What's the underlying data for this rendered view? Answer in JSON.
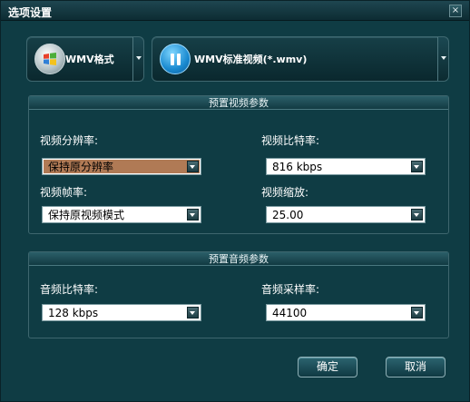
{
  "window": {
    "title": "选项设置",
    "close_glyph": "×"
  },
  "format": {
    "left": {
      "label": "WMV格式",
      "icon": "windows-logo-icon"
    },
    "right": {
      "label": "WMV标准视频(*.wmv)",
      "icon": "pause-icon"
    }
  },
  "video": {
    "heading": "预置视频参数",
    "resolution": {
      "label": "视频分辨率:",
      "value": "保持原分辨率"
    },
    "bitrate": {
      "label": "视频比特率:",
      "value": "816 kbps"
    },
    "framerate": {
      "label": "视频帧率:",
      "value": "保持原视频模式"
    },
    "zoom": {
      "label": "视频缩放:",
      "value": "25.00"
    }
  },
  "audio": {
    "heading": "预置音频参数",
    "bitrate": {
      "label": "音频比特率:",
      "value": "128 kbps"
    },
    "samplerate": {
      "label": "音频采样率:",
      "value": "44100"
    }
  },
  "buttons": {
    "ok": "确定",
    "cancel": "取消"
  },
  "colors": {
    "background": "#0f3c44",
    "selected_combo": "#b07a55"
  }
}
